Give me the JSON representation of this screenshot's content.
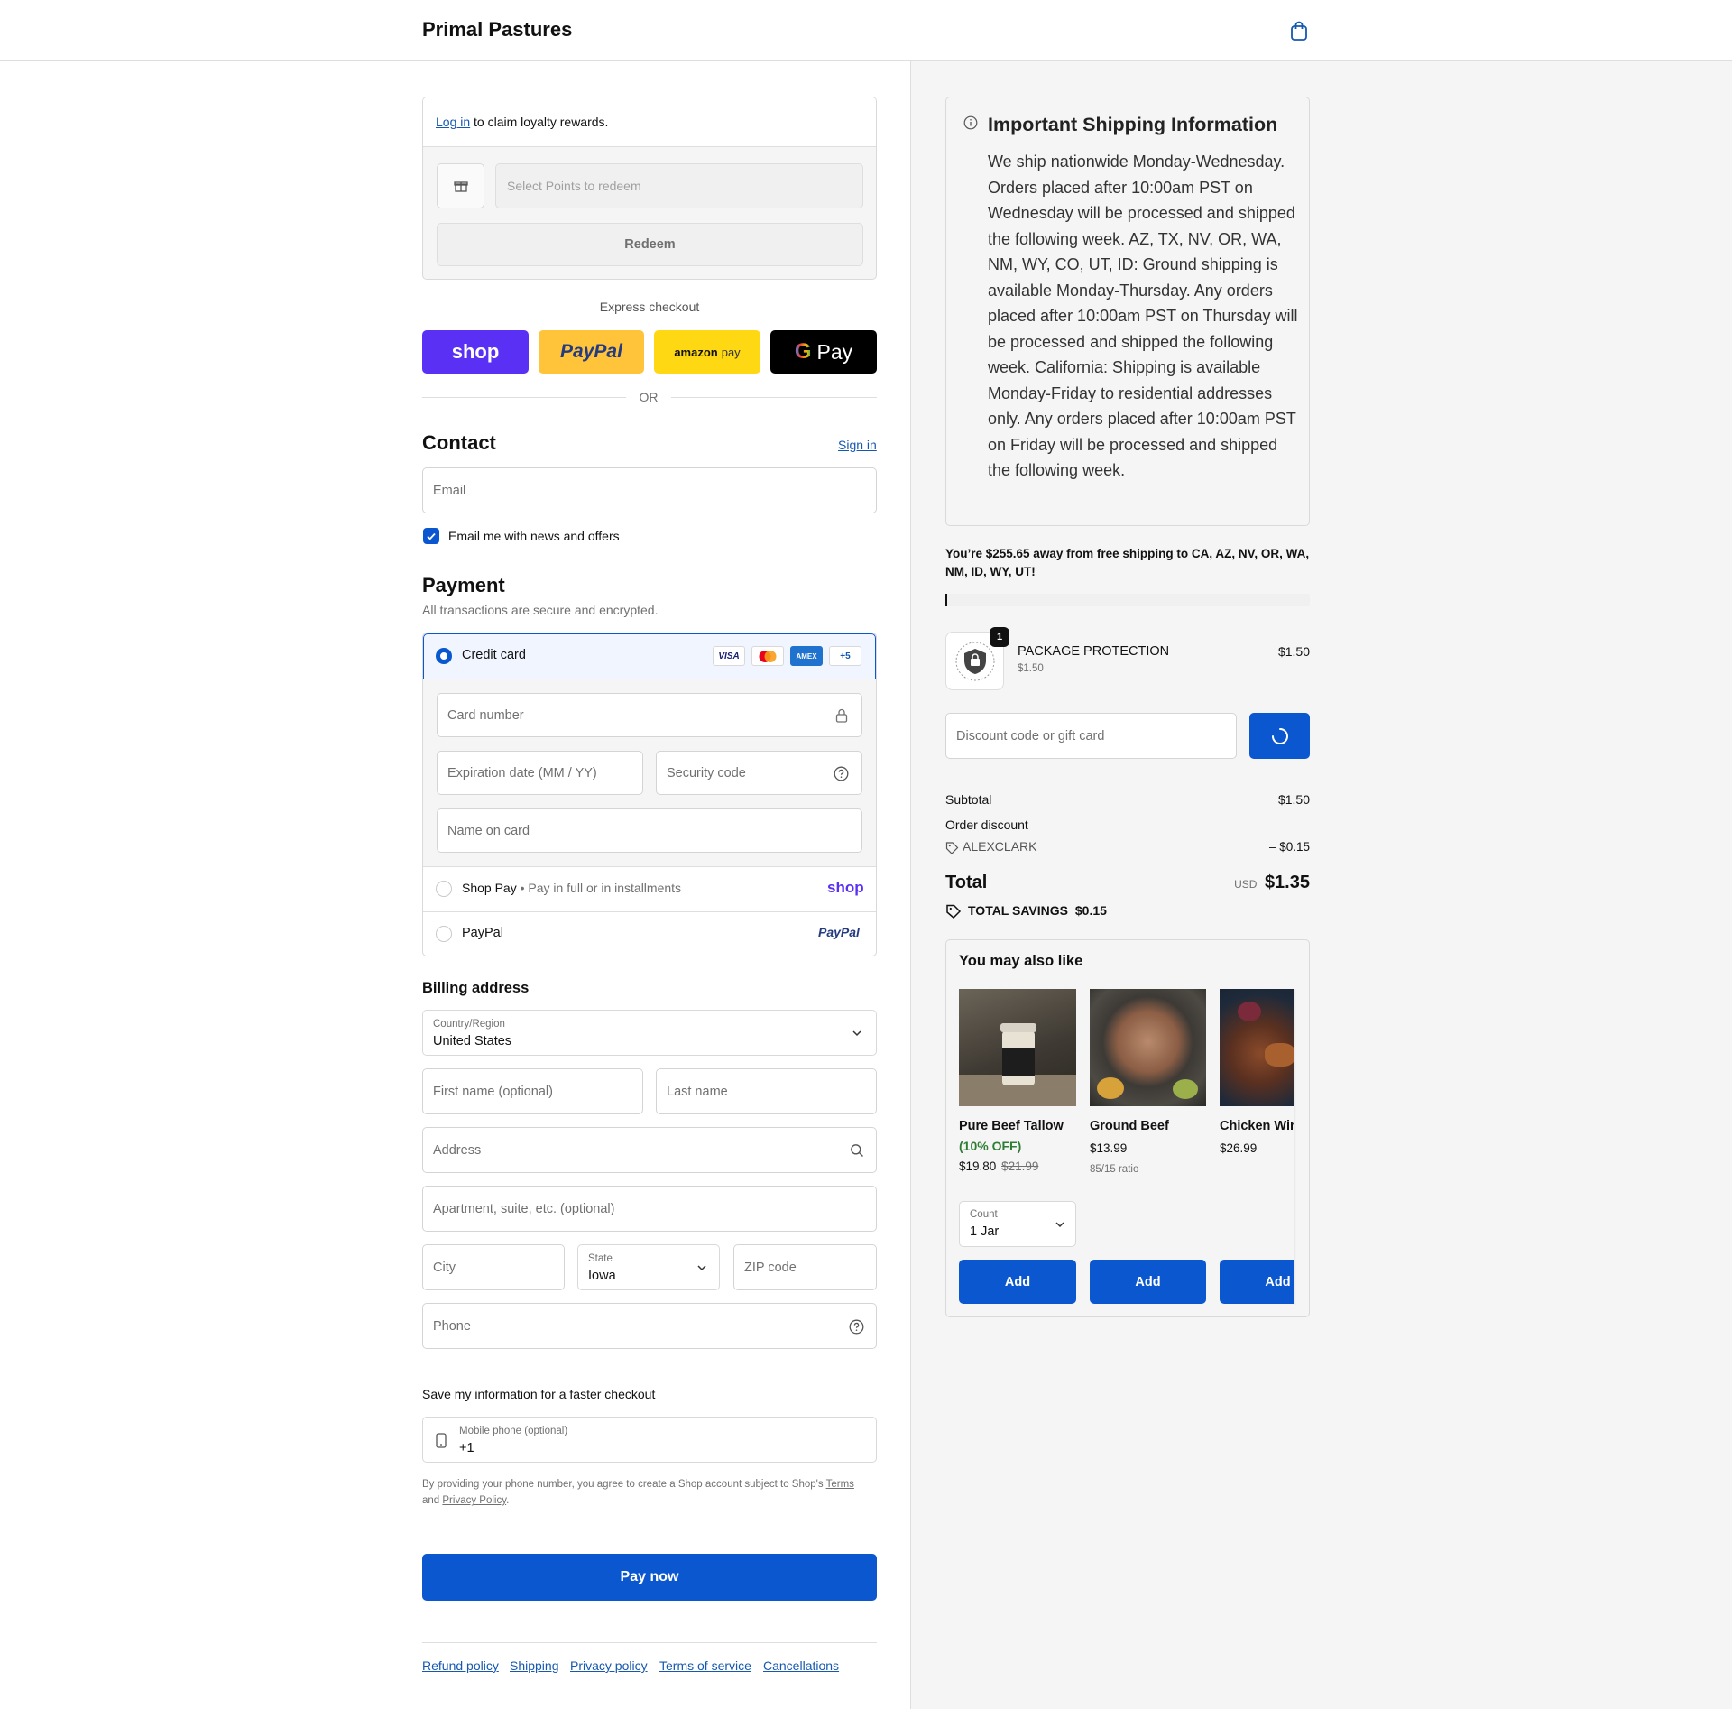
{
  "header": {
    "brand": "Primal Pastures",
    "cart_icon": "shopping-bag-icon"
  },
  "loyalty": {
    "login_link": "Log in",
    "text": "to claim loyalty rewards.",
    "points_placeholder": "Select Points to redeem",
    "redeem_label": "Redeem"
  },
  "express": {
    "title": "Express checkout",
    "shop_label": "shop",
    "paypal_label": "PayPal",
    "amazon_label": "amazon",
    "amazon_suffix": "pay",
    "gpay_label": "Pay",
    "or": "OR"
  },
  "contact": {
    "title": "Contact",
    "sign_in": "Sign in",
    "email_placeholder": "Email",
    "newsletter_label": "Email me with news and offers",
    "newsletter_checked": true
  },
  "payment": {
    "title": "Payment",
    "subtitle": "All transactions are secure and encrypted.",
    "credit_card_label": "Credit card",
    "card_logos": [
      "VISA",
      "MC",
      "AMEX",
      "+5"
    ],
    "card_number_placeholder": "Card number",
    "expiry_placeholder": "Expiration date (MM / YY)",
    "security_placeholder": "Security code",
    "name_placeholder": "Name on card",
    "shop_pay_label": "Shop Pay",
    "shop_pay_sub": "Pay in full or in installments",
    "shop_pay_logo": "shop",
    "paypal_label": "PayPal",
    "paypal_logo": "PayPal"
  },
  "billing": {
    "title": "Billing address",
    "country_label": "Country/Region",
    "country_value": "United States",
    "first_name_placeholder": "First name (optional)",
    "last_name_placeholder": "Last name",
    "address_placeholder": "Address",
    "apartment_placeholder": "Apartment, suite, etc. (optional)",
    "city_placeholder": "City",
    "state_label": "State",
    "state_value": "Iowa",
    "zip_placeholder": "ZIP code",
    "phone_placeholder": "Phone"
  },
  "save_info": {
    "title": "Save my information for a faster checkout",
    "mobile_label": "Mobile phone (optional)",
    "mobile_value": "+1",
    "disclaimer_prefix": "By providing your phone number, you agree to create a Shop account subject to Shop's",
    "terms_link": "Terms",
    "and": "and",
    "privacy_link": "Privacy Policy",
    "period": "."
  },
  "pay_now": "Pay now",
  "footer_links": [
    "Refund policy",
    "Shipping",
    "Privacy policy",
    "Terms of service",
    "Cancellations"
  ],
  "shipping_info": {
    "title": "Important Shipping Information",
    "body": "We ship nationwide Monday-Wednesday. Orders placed after 10:00am PST on Wednesday will be processed and shipped the following week. AZ, TX, NV, OR, WA, NM, WY, CO, UT, ID: Ground shipping is available Monday-Thursday. Any orders placed after 10:00am PST on Thursday will be processed and shipped the following week. California: Shipping is available Monday-Friday to residential addresses only. Any orders placed after 10:00am PST on Friday will be processed and shipped the following week."
  },
  "free_shipping": {
    "text": "You’re $255.65 away from free shipping to CA, AZ, NV, OR, WA, NM, ID, WY, UT!",
    "progress": 0.006
  },
  "line_item": {
    "quantity": "1",
    "name": "PACKAGE PROTECTION",
    "sub_price": "$1.50",
    "price": "$1.50"
  },
  "discount": {
    "placeholder": "Discount code or gift card"
  },
  "summary": {
    "subtotal_label": "Subtotal",
    "subtotal_value": "$1.50",
    "discount_label": "Order discount",
    "discount_code": "ALEXCLARK",
    "discount_value": "– $0.15",
    "total_label": "Total",
    "currency": "USD",
    "total_value": "$1.35",
    "savings_label": "TOTAL SAVINGS",
    "savings_value": "$0.15"
  },
  "upsell": {
    "title": "You may also like",
    "products": [
      {
        "name": "Pure Beef Tallow",
        "badge": "(10% OFF)",
        "price": "$19.80",
        "compare_price": "$21.99",
        "select_label": "Count",
        "select_value": "1 Jar",
        "add_label": "Add"
      },
      {
        "name": "Ground Beef",
        "price": "$13.99",
        "note": "85/15 ratio",
        "add_label": "Add"
      },
      {
        "name": "Chicken Wings",
        "price": "$26.99",
        "add_label": "Add"
      }
    ]
  }
}
